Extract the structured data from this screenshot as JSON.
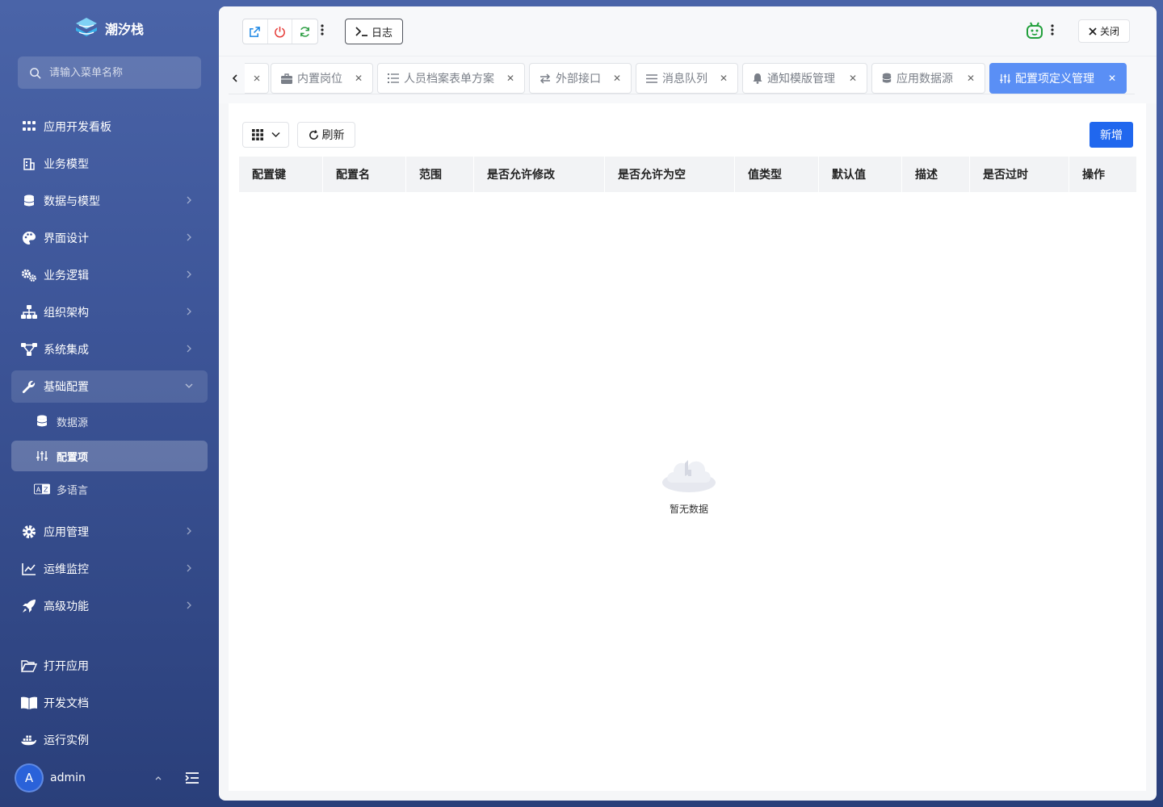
{
  "app": {
    "name": "潮汐栈"
  },
  "search": {
    "placeholder": "请输入菜单名称"
  },
  "sidebar": {
    "items": [
      {
        "label": "应用开发看板",
        "icon": "apps-grid-icon"
      },
      {
        "label": "业务模型",
        "icon": "building-icon"
      },
      {
        "label": "数据与模型",
        "icon": "database-icon"
      },
      {
        "label": "界面设计",
        "icon": "palette-icon"
      },
      {
        "label": "业务逻辑",
        "icon": "gears-icon"
      },
      {
        "label": "组织架构",
        "icon": "org-tree-icon"
      },
      {
        "label": "系统集成",
        "icon": "integration-icon"
      },
      {
        "label": "基础配置",
        "icon": "wrench-icon"
      },
      {
        "label": "应用管理",
        "icon": "gear-icon"
      },
      {
        "label": "运维监控",
        "icon": "chart-line-icon"
      },
      {
        "label": "高级功能",
        "icon": "rocket-icon"
      }
    ],
    "sub_items": [
      {
        "label": "数据源",
        "icon": "database-icon"
      },
      {
        "label": "配置项",
        "icon": "sliders-icon"
      },
      {
        "label": "多语言",
        "icon": "language-icon"
      }
    ],
    "bottom": [
      {
        "label": "打开应用",
        "icon": "folder-open-icon"
      },
      {
        "label": "开发文档",
        "icon": "book-icon"
      },
      {
        "label": "运行实例",
        "icon": "docker-icon"
      }
    ]
  },
  "user": {
    "avatar_letter": "A",
    "name": "admin"
  },
  "toolbar": {
    "log_label": "日志",
    "close_label": "关闭"
  },
  "tabs": [
    {
      "label": "内置岗位",
      "icon": "briefcase-icon"
    },
    {
      "label": "人员档案表单方案",
      "icon": "list-icon"
    },
    {
      "label": "外部接口",
      "icon": "exchange-icon"
    },
    {
      "label": "消息队列",
      "icon": "menu-lines-icon"
    },
    {
      "label": "通知模版管理",
      "icon": "bell-icon"
    },
    {
      "label": "应用数据源",
      "icon": "database-icon"
    },
    {
      "label": "配置项定义管理",
      "icon": "sliders-icon",
      "active": true
    }
  ],
  "content": {
    "refresh_label": "刷新",
    "add_label": "新增",
    "columns": [
      "配置键",
      "配置名",
      "范围",
      "是否允许修改",
      "是否允许为空",
      "值类型",
      "默认值",
      "描述",
      "是否过时",
      "操作"
    ],
    "empty_text": "暂无数据"
  },
  "colors": {
    "primary": "#2067ee",
    "active_tab": "#5a8ff5",
    "sidebar": "#3d5598"
  }
}
